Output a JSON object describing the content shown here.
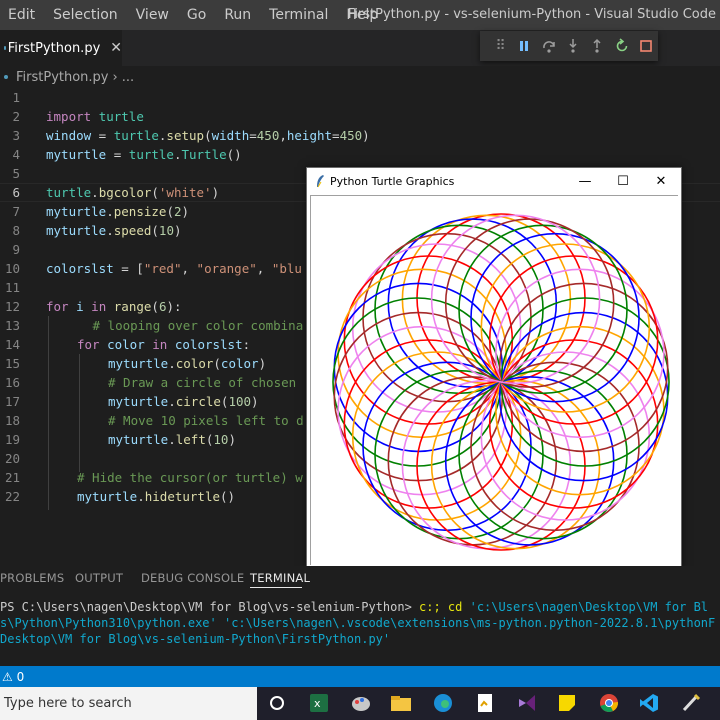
{
  "menubar": {
    "items": [
      "Edit",
      "Selection",
      "View",
      "Go",
      "Run",
      "Terminal",
      "Help"
    ],
    "window_title": "FirstPython.py - vs-selenium-Python - Visual Studio Code"
  },
  "tab": {
    "label": "FirstPython.py",
    "close": "✕"
  },
  "breadcrumb": {
    "file": "FirstPython.py",
    "sep": "›",
    "more": "..."
  },
  "editor": {
    "lines": [
      {
        "n": "1",
        "indent": 0,
        "tokens": []
      },
      {
        "n": "2",
        "indent": 0,
        "tokens": [
          [
            "kw",
            "import"
          ],
          [
            "pl",
            " "
          ],
          [
            "cls",
            "turtle"
          ]
        ]
      },
      {
        "n": "3",
        "indent": 0,
        "tokens": [
          [
            "var",
            "window"
          ],
          [
            "pl",
            " = "
          ],
          [
            "cls",
            "turtle"
          ],
          [
            "pl",
            "."
          ],
          [
            "fn",
            "setup"
          ],
          [
            "pl",
            "("
          ],
          [
            "var",
            "width"
          ],
          [
            "pl",
            "="
          ],
          [
            "num",
            "450"
          ],
          [
            "pl",
            ","
          ],
          [
            "var",
            "height"
          ],
          [
            "pl",
            "="
          ],
          [
            "num",
            "450"
          ],
          [
            "pl",
            ")"
          ]
        ]
      },
      {
        "n": "4",
        "indent": 0,
        "tokens": [
          [
            "var",
            "myturtle"
          ],
          [
            "pl",
            " = "
          ],
          [
            "cls",
            "turtle"
          ],
          [
            "pl",
            "."
          ],
          [
            "cls",
            "Turtle"
          ],
          [
            "pl",
            "()"
          ]
        ]
      },
      {
        "n": "5",
        "indent": 0,
        "tokens": []
      },
      {
        "n": "6",
        "indent": 0,
        "tokens": [
          [
            "cls",
            "turtle"
          ],
          [
            "pl",
            "."
          ],
          [
            "fn",
            "bgcolor"
          ],
          [
            "pl",
            "("
          ],
          [
            "str",
            "'white'"
          ],
          [
            "pl",
            ")"
          ]
        ]
      },
      {
        "n": "7",
        "indent": 0,
        "tokens": [
          [
            "var",
            "myturtle"
          ],
          [
            "pl",
            "."
          ],
          [
            "fn",
            "pensize"
          ],
          [
            "pl",
            "("
          ],
          [
            "num",
            "2"
          ],
          [
            "pl",
            ")"
          ]
        ]
      },
      {
        "n": "8",
        "indent": 0,
        "tokens": [
          [
            "var",
            "myturtle"
          ],
          [
            "pl",
            "."
          ],
          [
            "fn",
            "speed"
          ],
          [
            "pl",
            "("
          ],
          [
            "num",
            "10"
          ],
          [
            "pl",
            ")"
          ]
        ]
      },
      {
        "n": "9",
        "indent": 0,
        "tokens": []
      },
      {
        "n": "10",
        "indent": 0,
        "tokens": [
          [
            "var",
            "colorslst"
          ],
          [
            "pl",
            " = ["
          ],
          [
            "str",
            "\"red\""
          ],
          [
            "pl",
            ", "
          ],
          [
            "str",
            "\"orange\""
          ],
          [
            "pl",
            ", "
          ],
          [
            "str",
            "\"blu"
          ]
        ]
      },
      {
        "n": "11",
        "indent": 0,
        "tokens": []
      },
      {
        "n": "12",
        "indent": 0,
        "tokens": [
          [
            "kw",
            "for"
          ],
          [
            "pl",
            " "
          ],
          [
            "var",
            "i"
          ],
          [
            "pl",
            " "
          ],
          [
            "kw",
            "in"
          ],
          [
            "pl",
            " "
          ],
          [
            "fn",
            "range"
          ],
          [
            "pl",
            "("
          ],
          [
            "num",
            "6"
          ],
          [
            "pl",
            "):"
          ]
        ]
      },
      {
        "n": "13",
        "indent": 3,
        "tokens": [
          [
            "cm",
            "# looping over color combina"
          ]
        ]
      },
      {
        "n": "14",
        "indent": 2,
        "tokens": [
          [
            "kw",
            "for"
          ],
          [
            "pl",
            " "
          ],
          [
            "var",
            "color"
          ],
          [
            "pl",
            " "
          ],
          [
            "kw",
            "in"
          ],
          [
            "pl",
            " "
          ],
          [
            "var",
            "colorslst"
          ],
          [
            "pl",
            ":"
          ]
        ]
      },
      {
        "n": "15",
        "indent": 4,
        "tokens": [
          [
            "var",
            "myturtle"
          ],
          [
            "pl",
            "."
          ],
          [
            "fn",
            "color"
          ],
          [
            "pl",
            "("
          ],
          [
            "var",
            "color"
          ],
          [
            "pl",
            ")"
          ]
        ]
      },
      {
        "n": "16",
        "indent": 4,
        "tokens": [
          [
            "cm",
            "# Draw a circle of chosen"
          ]
        ]
      },
      {
        "n": "17",
        "indent": 4,
        "tokens": [
          [
            "var",
            "myturtle"
          ],
          [
            "pl",
            "."
          ],
          [
            "fn",
            "circle"
          ],
          [
            "pl",
            "("
          ],
          [
            "num",
            "100"
          ],
          [
            "pl",
            ")"
          ]
        ]
      },
      {
        "n": "18",
        "indent": 4,
        "tokens": [
          [
            "cm",
            "# Move 10 pixels left to d"
          ]
        ]
      },
      {
        "n": "19",
        "indent": 4,
        "tokens": [
          [
            "var",
            "myturtle"
          ],
          [
            "pl",
            "."
          ],
          [
            "fn",
            "left"
          ],
          [
            "pl",
            "("
          ],
          [
            "num",
            "10"
          ],
          [
            "pl",
            ")"
          ]
        ]
      },
      {
        "n": "20",
        "indent": 0,
        "tokens": []
      },
      {
        "n": "21",
        "indent": 2,
        "tokens": [
          [
            "cm",
            "# Hide the cursor(or turtle) w"
          ]
        ]
      },
      {
        "n": "22",
        "indent": 2,
        "tokens": [
          [
            "var",
            "myturtle"
          ],
          [
            "pl",
            "."
          ],
          [
            "fn",
            "hideturtle"
          ],
          [
            "pl",
            "()"
          ]
        ]
      }
    ]
  },
  "turtle_window": {
    "title": "Python Turtle Graphics",
    "minimize": "—",
    "maximize": "☐",
    "close": "✕",
    "colors": [
      "#ff0000",
      "#ffa500",
      "#0000ff",
      "#008000",
      "#a52a2a",
      "#ee82ee"
    ],
    "circle_radius": 100,
    "turn_deg": 10,
    "repeats": 6
  },
  "panel": {
    "tabs": [
      "PROBLEMS",
      "OUTPUT",
      "DEBUG CONSOLE",
      "TERMINAL"
    ],
    "terminal": {
      "prompt": "PS C:\\Users\\nagen\\Desktop\\VM for Blog\\vs-selenium-Python> ",
      "cmd": "c:; cd ",
      "arg1": "'c:\\Users\\nagen\\Desktop\\VM for Bl",
      "line2": "s\\Python\\Python310\\python.exe' 'c:\\Users\\nagen\\.vscode\\extensions\\ms-python.python-2022.8.1\\pythonF",
      "line3": "Desktop\\VM for Blog\\vs-selenium-Python\\FirstPython.py'"
    }
  },
  "statusbar": {
    "warnings": "⚠ 0"
  },
  "taskbar": {
    "search_placeholder": "Type here to search"
  }
}
